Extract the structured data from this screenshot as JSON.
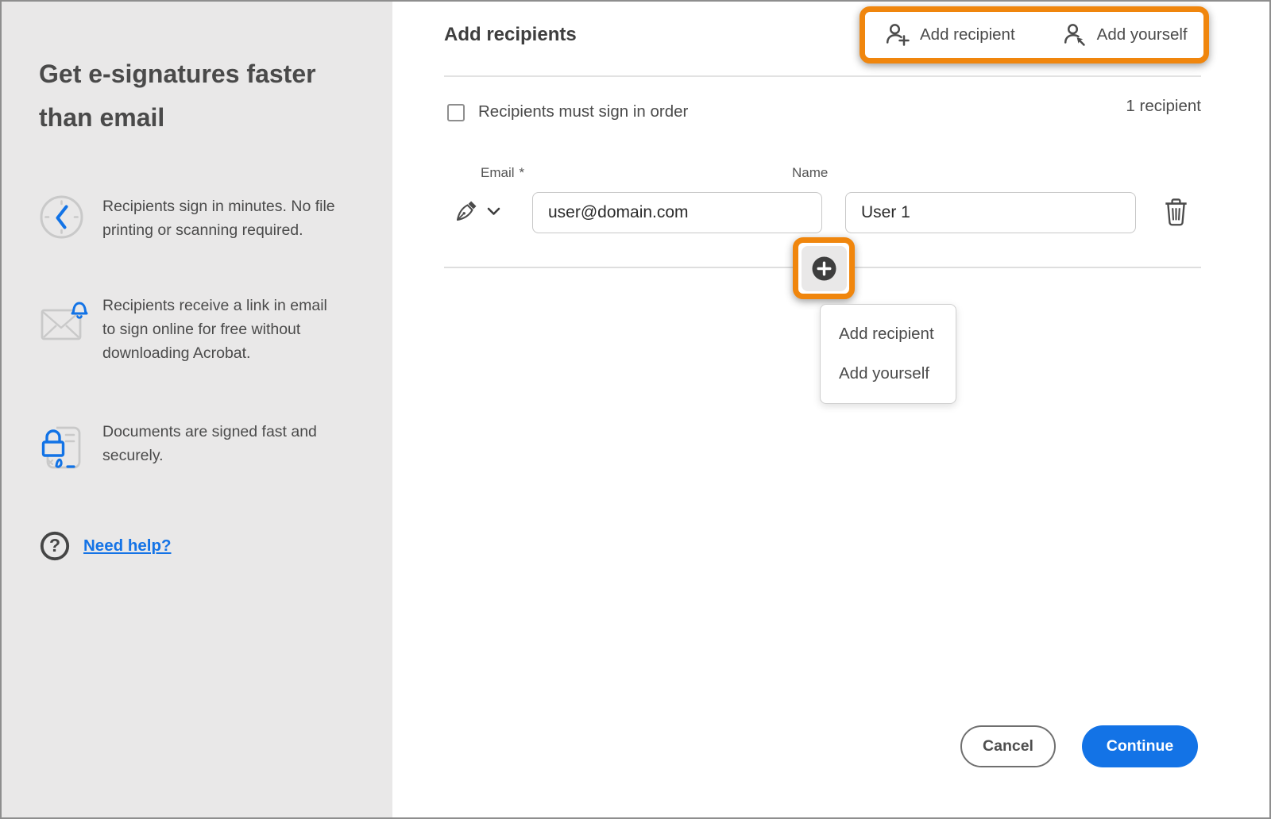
{
  "sidebar": {
    "heading": "Get e-signatures faster than email",
    "features": [
      {
        "icon": "clock-icon",
        "text": "Recipients sign in minutes. No file printing or scanning required."
      },
      {
        "icon": "email-notification-icon",
        "text": "Recipients receive a link in email to sign online for free without downloading Acrobat."
      },
      {
        "icon": "secure-document-icon",
        "text": "Documents are signed fast and securely."
      }
    ],
    "help_link": "Need help?"
  },
  "main": {
    "title": "Add recipients",
    "toolbar": {
      "add_recipient_label": "Add recipient",
      "add_yourself_label": "Add yourself"
    },
    "sign_in_order_label": "Recipients must sign in order",
    "recipient_count": "1 recipient",
    "recipient": {
      "email_label": "Email",
      "email_required_mark": "*",
      "email_value": "user@domain.com",
      "name_label": "Name",
      "name_value": "User 1"
    },
    "add_menu": {
      "items": [
        "Add recipient",
        "Add yourself"
      ]
    },
    "footer": {
      "cancel_label": "Cancel",
      "continue_label": "Continue"
    }
  },
  "icons": {
    "clock": "clock-icon",
    "email_notification": "email-notification-icon",
    "secure_document": "secure-document-icon",
    "help": "question-circle-icon",
    "add_recipient": "person-plus-icon",
    "add_yourself": "person-arrow-icon",
    "role": "pen-nib-icon",
    "role_expand": "chevron-down-icon",
    "delete": "trash-icon",
    "add": "plus-icon"
  },
  "colors": {
    "accent_blue": "#1373e6",
    "annotation_orange": "#f0860d",
    "link_blue": "#1473e6",
    "sidebar_bg": "#e9e8e8",
    "icon_gray": "#c9c9c9",
    "text_dark": "#4b4b4b"
  }
}
